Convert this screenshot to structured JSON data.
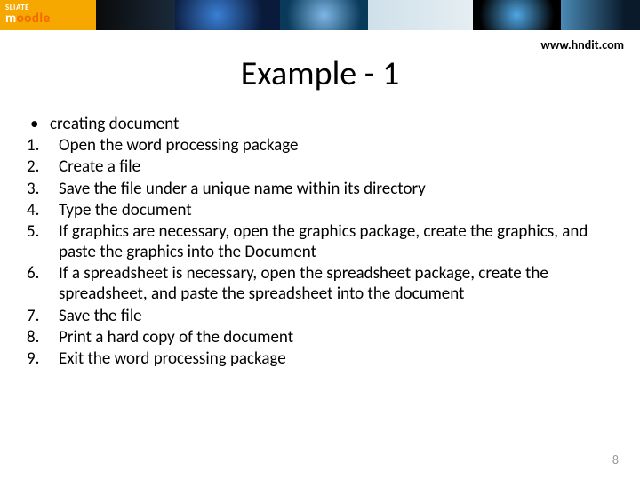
{
  "banner": {
    "logo_prefix": "SLIATE",
    "logo_main_white": "m",
    "logo_main_orange": "oodle"
  },
  "header": {
    "url": "www.hndit.com"
  },
  "title": "Example - 1",
  "bullet": {
    "text": "creating document"
  },
  "steps": [
    {
      "n": "1.",
      "text": " Open the word processing package"
    },
    {
      "n": "2.",
      "text": "Create a file"
    },
    {
      "n": "3.",
      "text": "Save the file under a unique name within its directory"
    },
    {
      "n": "4.",
      "text": "Type the document"
    },
    {
      "n": "5.",
      "text": " If graphics are necessary, open the graphics package, create the graphics, and paste the graphics into the Document"
    },
    {
      "n": "6.",
      "text": " If a spreadsheet is necessary, open the spreadsheet package, create the spreadsheet, and paste the spreadsheet into the document"
    },
    {
      "n": "7.",
      "text": "Save the file"
    },
    {
      "n": "8.",
      "text": "Print a hard copy of the document"
    },
    {
      "n": "9.",
      "text": "Exit the word processing package"
    }
  ],
  "page_number": "8"
}
